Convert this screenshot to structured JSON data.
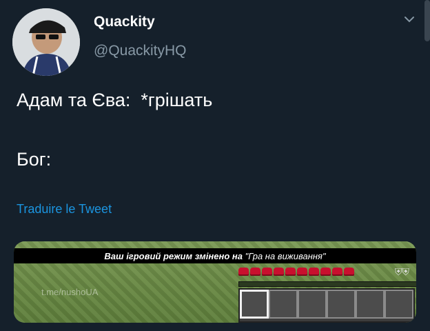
{
  "tweet": {
    "author_name": "Quackity",
    "author_handle": "@QuackityHQ",
    "text_line1": "Адам та Єва:  *грішать",
    "text_line2": "Бог:",
    "translate_label": "Traduire le Tweet"
  },
  "media": {
    "mode_message_prefix": "Ваш ігровий режим змінено на",
    "mode_message_value": "\"Гра на виживання\"",
    "watermark": "t.me/nushoUA",
    "hearts_count": 10,
    "hotbar_slots": 6,
    "selected_slot": 1
  },
  "icons": {
    "avatar": "avatar",
    "chevron": "chevron-down-icon"
  },
  "colors": {
    "background": "#15202b",
    "link": "#1b95e0",
    "muted": "#8899a6"
  }
}
